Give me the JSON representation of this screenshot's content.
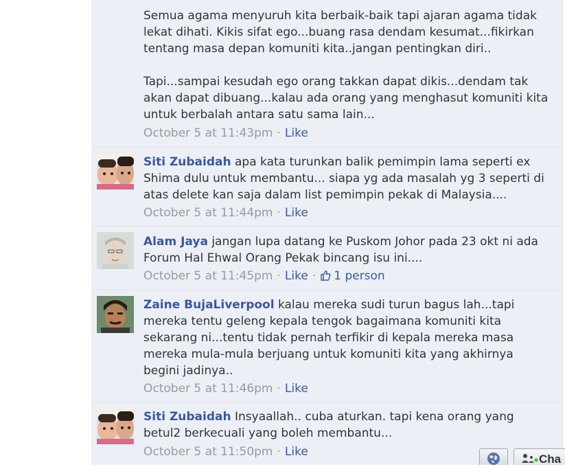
{
  "comments": [
    {
      "author": "",
      "text": "Semua agama menyuruh kita berbaik-baik tapi ajaran agama tidak lekat dihati. Kikis sifat ego...buang rasa dendam kesumat...fikirkan tentang masa depan komuniti kita..jangan pentingkan diri..\n\nTapi...sampai kesudah ego orang takkan dapat dikis...dendam tak akan dapat dibuang...kalau ada orang yang menghasut komuniti kita untuk berbalah antara satu sama lain...",
      "timestamp": "October 5 at 11:43pm",
      "like": "Like"
    },
    {
      "author": "Siti Zubaidah",
      "text": "apa kata turunkan balik pemimpin lama seperti ex Shima dulu untuk membantu... siapa yg ada masalah yg 3 seperti di atas delete kan saja dalam list pemimpin pekak di Malaysia....",
      "timestamp": "October 5 at 11:44pm",
      "like": "Like"
    },
    {
      "author": "Alam Jaya",
      "text": "jangan lupa datang ke Puskom Johor pada 23 okt ni ada Forum Hal Ehwal Orang Pekak bincang isu ini....",
      "timestamp": "October 5 at 11:45pm",
      "like": "Like",
      "likes_count": "1 person"
    },
    {
      "author": "Zaine BujaLiverpool",
      "text": "kalau mereka sudi turun bagus lah...tapi mereka tentu geleng kepala tengok bagaimana komuniti kita sekarang ni...tentu tidak pernah terfikir di kepala mereka masa mereka mula-mula berjuang untuk komuniti kita yang akhirnya begini jadinya..",
      "timestamp": "October 5 at 11:46pm",
      "like": "Like"
    },
    {
      "author": "Siti Zubaidah",
      "text": "Insyaallah.. cuba aturkan. tapi kena orang yang betul2 berkecuali yang boleh membantu...",
      "timestamp": "October 5 at 11:50pm",
      "like": "Like"
    }
  ],
  "chat": {
    "label": "Cha"
  },
  "colors": {
    "link": "#3b5998",
    "feed_bg": "#eceff5",
    "meta": "#999999"
  }
}
